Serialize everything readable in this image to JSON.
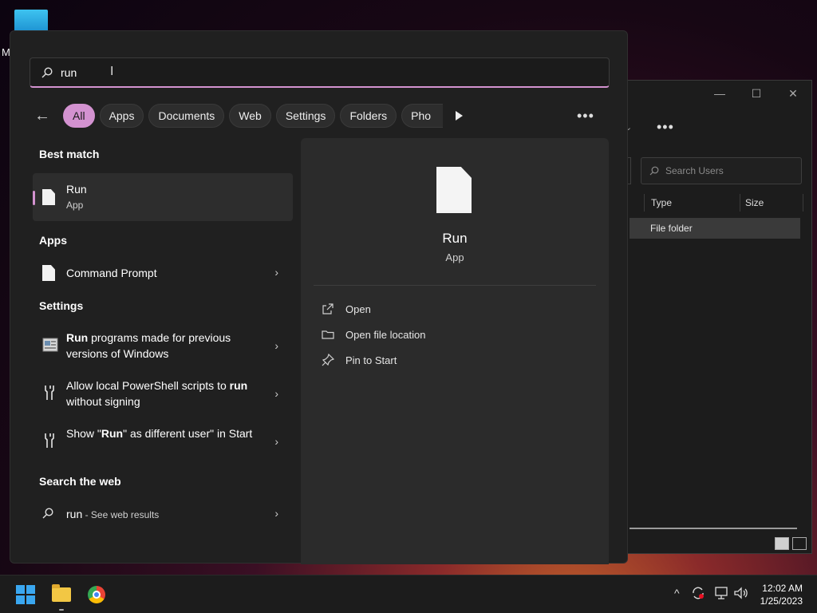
{
  "desktop": {
    "icon_letter": "M"
  },
  "explorer": {
    "search_placeholder": "Search Users",
    "columns": [
      "Type",
      "Size"
    ],
    "row_type": "File folder",
    "more_label": "•••",
    "minimize": "—",
    "maximize": "☐",
    "close": "✕"
  },
  "search": {
    "query": "run",
    "placeholder": ""
  },
  "filters": {
    "back": "←",
    "chips": [
      "All",
      "Apps",
      "Documents",
      "Web",
      "Settings",
      "Folders",
      "Pho"
    ],
    "more": "•••"
  },
  "sections": {
    "best_match": "Best match",
    "apps": "Apps",
    "settings": "Settings",
    "web": "Search the web"
  },
  "best_match": {
    "title": "Run",
    "subtitle": "App"
  },
  "apps": [
    {
      "label": "Command Prompt"
    }
  ],
  "settings_items": [
    {
      "bold": "Run",
      "rest": " programs made for previous versions of Windows"
    },
    {
      "pre": "Allow local PowerShell scripts to ",
      "bold": "run",
      "rest": " without signing"
    },
    {
      "pre": "Show \"",
      "bold": "Run",
      "rest": "\" as different user\" in Start"
    }
  ],
  "web": {
    "query": "run",
    "suffix": " - See web results"
  },
  "preview": {
    "title": "Run",
    "subtitle": "App",
    "actions": [
      "Open",
      "Open file location",
      "Pin to Start"
    ]
  },
  "taskbar": {
    "tray_chevron": "^",
    "time": "12:02 AM",
    "date": "1/25/2023"
  },
  "colors": {
    "accent": "#d392d0",
    "panel": "#202020",
    "preview": "#2b2b2b"
  }
}
